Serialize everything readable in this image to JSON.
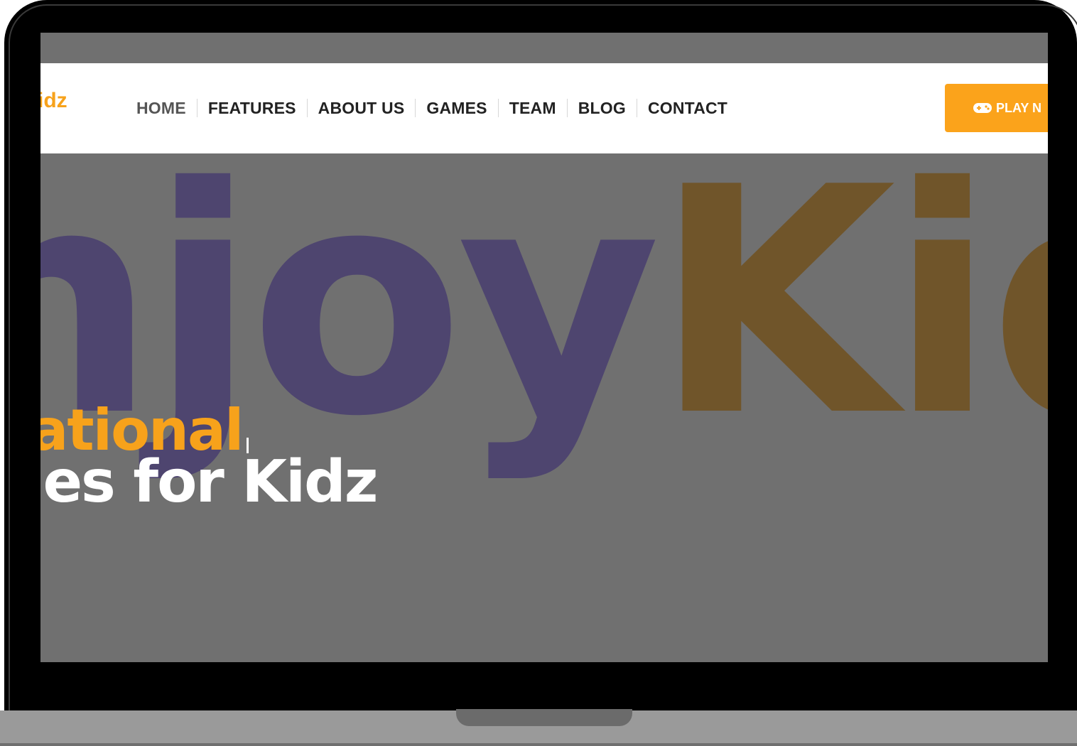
{
  "brand": {
    "logo_text": "idz",
    "accent_color": "#f7a21b",
    "purple_color": "#4e456f"
  },
  "hero_background": {
    "text_purple": "njoy",
    "text_orange": "Kid."
  },
  "nav": {
    "items": [
      "HOME",
      "FEATURES",
      "ABOUT US",
      "GAMES",
      "TEAM",
      "BLOG",
      "CONTACT"
    ]
  },
  "cta": {
    "icon": "gamepad-icon",
    "label": "PLAY N"
  },
  "hero": {
    "line1": "cational",
    "line2": "mes for Kidz"
  }
}
